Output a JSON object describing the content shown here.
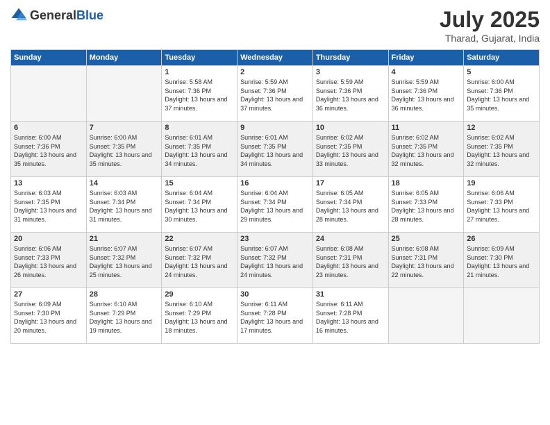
{
  "logo": {
    "general": "General",
    "blue": "Blue"
  },
  "header": {
    "title": "July 2025",
    "subtitle": "Tharad, Gujarat, India"
  },
  "weekdays": [
    "Sunday",
    "Monday",
    "Tuesday",
    "Wednesday",
    "Thursday",
    "Friday",
    "Saturday"
  ],
  "weeks": [
    [
      {
        "day": "",
        "info": ""
      },
      {
        "day": "",
        "info": ""
      },
      {
        "day": "1",
        "info": "Sunrise: 5:58 AM\nSunset: 7:36 PM\nDaylight: 13 hours and 37 minutes."
      },
      {
        "day": "2",
        "info": "Sunrise: 5:59 AM\nSunset: 7:36 PM\nDaylight: 13 hours and 37 minutes."
      },
      {
        "day": "3",
        "info": "Sunrise: 5:59 AM\nSunset: 7:36 PM\nDaylight: 13 hours and 36 minutes."
      },
      {
        "day": "4",
        "info": "Sunrise: 5:59 AM\nSunset: 7:36 PM\nDaylight: 13 hours and 36 minutes."
      },
      {
        "day": "5",
        "info": "Sunrise: 6:00 AM\nSunset: 7:36 PM\nDaylight: 13 hours and 35 minutes."
      }
    ],
    [
      {
        "day": "6",
        "info": "Sunrise: 6:00 AM\nSunset: 7:36 PM\nDaylight: 13 hours and 35 minutes."
      },
      {
        "day": "7",
        "info": "Sunrise: 6:00 AM\nSunset: 7:35 PM\nDaylight: 13 hours and 35 minutes."
      },
      {
        "day": "8",
        "info": "Sunrise: 6:01 AM\nSunset: 7:35 PM\nDaylight: 13 hours and 34 minutes."
      },
      {
        "day": "9",
        "info": "Sunrise: 6:01 AM\nSunset: 7:35 PM\nDaylight: 13 hours and 34 minutes."
      },
      {
        "day": "10",
        "info": "Sunrise: 6:02 AM\nSunset: 7:35 PM\nDaylight: 13 hours and 33 minutes."
      },
      {
        "day": "11",
        "info": "Sunrise: 6:02 AM\nSunset: 7:35 PM\nDaylight: 13 hours and 32 minutes."
      },
      {
        "day": "12",
        "info": "Sunrise: 6:02 AM\nSunset: 7:35 PM\nDaylight: 13 hours and 32 minutes."
      }
    ],
    [
      {
        "day": "13",
        "info": "Sunrise: 6:03 AM\nSunset: 7:35 PM\nDaylight: 13 hours and 31 minutes."
      },
      {
        "day": "14",
        "info": "Sunrise: 6:03 AM\nSunset: 7:34 PM\nDaylight: 13 hours and 31 minutes."
      },
      {
        "day": "15",
        "info": "Sunrise: 6:04 AM\nSunset: 7:34 PM\nDaylight: 13 hours and 30 minutes."
      },
      {
        "day": "16",
        "info": "Sunrise: 6:04 AM\nSunset: 7:34 PM\nDaylight: 13 hours and 29 minutes."
      },
      {
        "day": "17",
        "info": "Sunrise: 6:05 AM\nSunset: 7:34 PM\nDaylight: 13 hours and 28 minutes."
      },
      {
        "day": "18",
        "info": "Sunrise: 6:05 AM\nSunset: 7:33 PM\nDaylight: 13 hours and 28 minutes."
      },
      {
        "day": "19",
        "info": "Sunrise: 6:06 AM\nSunset: 7:33 PM\nDaylight: 13 hours and 27 minutes."
      }
    ],
    [
      {
        "day": "20",
        "info": "Sunrise: 6:06 AM\nSunset: 7:33 PM\nDaylight: 13 hours and 26 minutes."
      },
      {
        "day": "21",
        "info": "Sunrise: 6:07 AM\nSunset: 7:32 PM\nDaylight: 13 hours and 25 minutes."
      },
      {
        "day": "22",
        "info": "Sunrise: 6:07 AM\nSunset: 7:32 PM\nDaylight: 13 hours and 24 minutes."
      },
      {
        "day": "23",
        "info": "Sunrise: 6:07 AM\nSunset: 7:32 PM\nDaylight: 13 hours and 24 minutes."
      },
      {
        "day": "24",
        "info": "Sunrise: 6:08 AM\nSunset: 7:31 PM\nDaylight: 13 hours and 23 minutes."
      },
      {
        "day": "25",
        "info": "Sunrise: 6:08 AM\nSunset: 7:31 PM\nDaylight: 13 hours and 22 minutes."
      },
      {
        "day": "26",
        "info": "Sunrise: 6:09 AM\nSunset: 7:30 PM\nDaylight: 13 hours and 21 minutes."
      }
    ],
    [
      {
        "day": "27",
        "info": "Sunrise: 6:09 AM\nSunset: 7:30 PM\nDaylight: 13 hours and 20 minutes."
      },
      {
        "day": "28",
        "info": "Sunrise: 6:10 AM\nSunset: 7:29 PM\nDaylight: 13 hours and 19 minutes."
      },
      {
        "day": "29",
        "info": "Sunrise: 6:10 AM\nSunset: 7:29 PM\nDaylight: 13 hours and 18 minutes."
      },
      {
        "day": "30",
        "info": "Sunrise: 6:11 AM\nSunset: 7:28 PM\nDaylight: 13 hours and 17 minutes."
      },
      {
        "day": "31",
        "info": "Sunrise: 6:11 AM\nSunset: 7:28 PM\nDaylight: 13 hours and 16 minutes."
      },
      {
        "day": "",
        "info": ""
      },
      {
        "day": "",
        "info": ""
      }
    ]
  ]
}
